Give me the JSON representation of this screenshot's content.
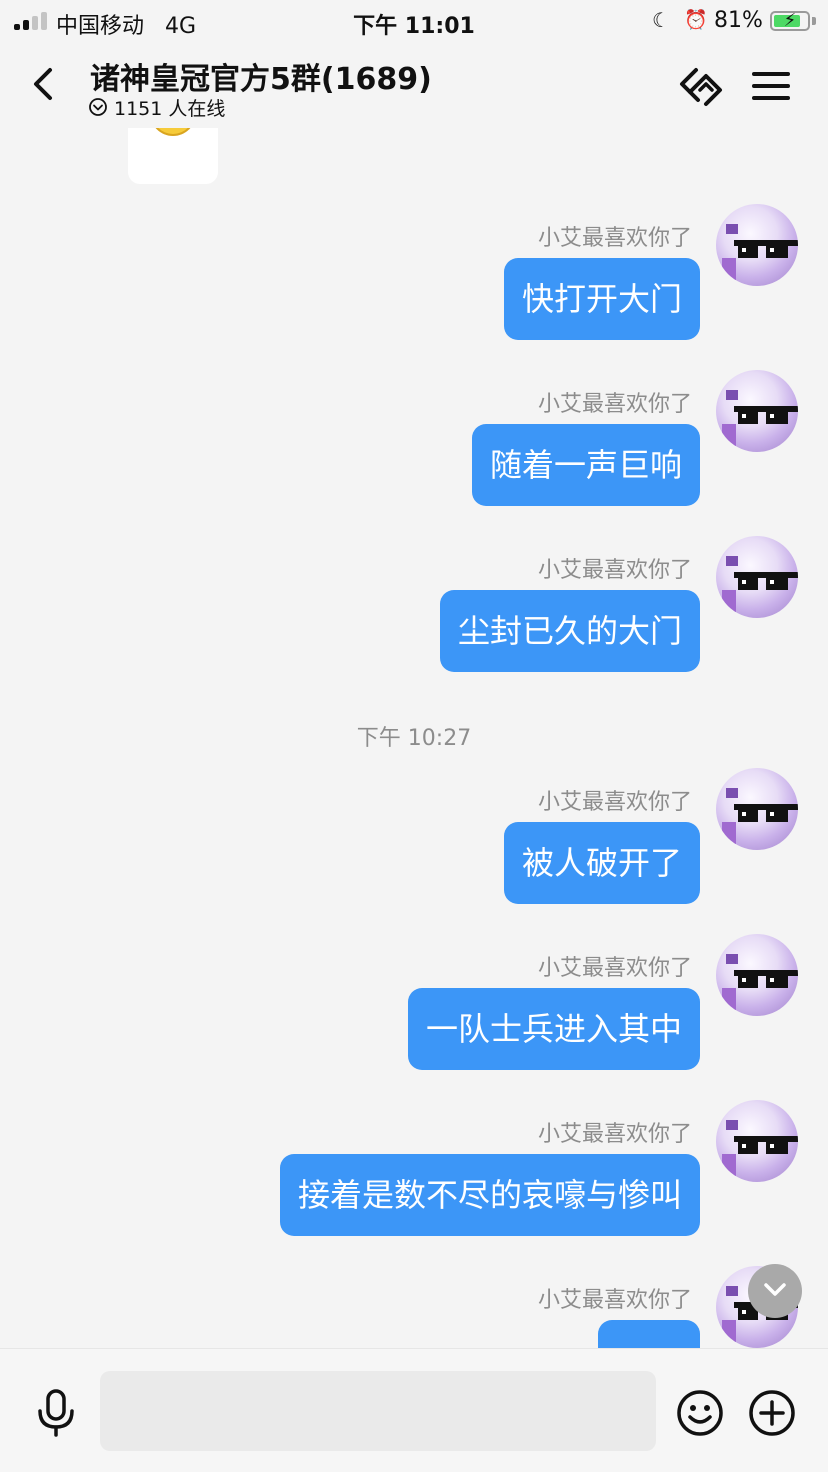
{
  "status_bar": {
    "carrier": "中国移动",
    "network": "4G",
    "time": "下午 11:01",
    "battery": "81%",
    "battery_level": 0.81,
    "icons": [
      "signal-icon",
      "moon-icon",
      "alarm-icon",
      "battery-icon",
      "charging-bolt-icon"
    ]
  },
  "header": {
    "title": "诸神皇冠官方5群(1689)",
    "online": "1151 人在线",
    "icons": [
      "back-chevron-icon",
      "online-dropdown-icon",
      "call-icon",
      "menu-icon"
    ]
  },
  "chat": {
    "messages": [
      {
        "sender": "小艾最喜欢你了",
        "text": "快打开大门"
      },
      {
        "sender": "小艾最喜欢你了",
        "text": "随着一声巨响"
      },
      {
        "sender": "小艾最喜欢你了",
        "text": "尘封已久的大门"
      },
      {
        "divider": "下午 10:27"
      },
      {
        "sender": "小艾最喜欢你了",
        "text": "被人破开了"
      },
      {
        "sender": "小艾最喜欢你了",
        "text": "一队士兵进入其中"
      },
      {
        "sender": "小艾最喜欢你了",
        "text": "接着是数不尽的哀嚎与惨叫"
      },
      {
        "sender": "小艾最喜欢你了",
        "text": ""
      }
    ],
    "previous_sticker": "smiley-face-sticker",
    "scroll_button_icon": "chevron-down-icon"
  },
  "input_bar": {
    "value": "",
    "placeholder": "",
    "icons": [
      "microphone-icon",
      "emoji-icon",
      "plus-icon"
    ]
  },
  "colors": {
    "bubble": "#3c96f7",
    "background": "#f4f4f4",
    "sender_text": "#8c8c8c",
    "battery_fill": "#4cd964"
  }
}
